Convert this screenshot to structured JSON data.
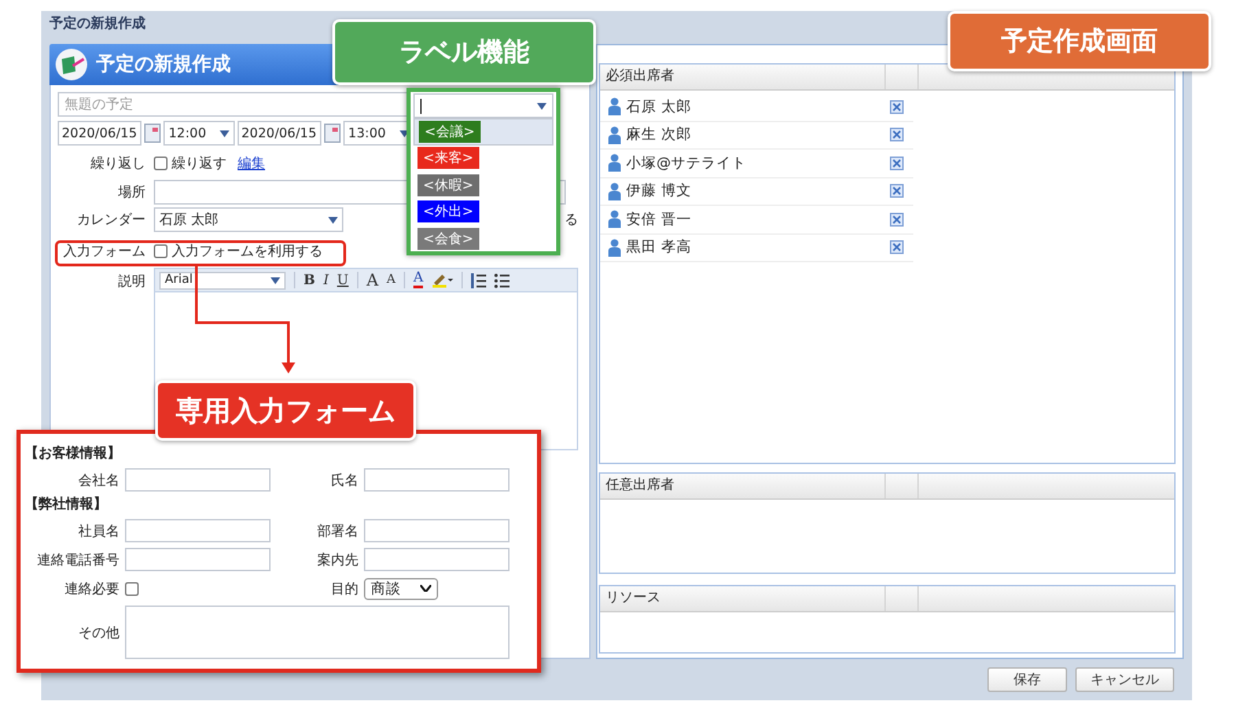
{
  "window": {
    "title": "予定の新規作成"
  },
  "header": {
    "title": "予定の新規作成"
  },
  "form": {
    "title_placeholder": "無題の予定",
    "start_date": "2020/06/15",
    "start_time": "12:00",
    "end_date": "2020/06/15",
    "end_time": "13:00",
    "repeat": {
      "label": "繰り返し",
      "checked": false,
      "option": "繰り返す",
      "link": "編集"
    },
    "location": {
      "label": "場所"
    },
    "calendar": {
      "label": "カレンダー",
      "value": "石原 太郎",
      "trailing": "る"
    },
    "input_form": {
      "label": "入力フォーム",
      "checked": false,
      "option": "入力フォームを利用する"
    },
    "description": {
      "label": "説明",
      "font": "Arial",
      "toolbar": [
        {
          "kind": "bold",
          "text": "B"
        },
        {
          "kind": "italic",
          "text": "I"
        },
        {
          "kind": "underline",
          "text": "U"
        },
        {
          "kind": "grow",
          "text": "A"
        },
        {
          "kind": "shrink",
          "text": "A"
        },
        {
          "kind": "color",
          "text": "A"
        },
        {
          "kind": "highlight"
        },
        {
          "kind": "ordered"
        },
        {
          "kind": "bullets"
        }
      ]
    }
  },
  "label_menu": {
    "items": [
      {
        "text": "<会議>",
        "color": "#2e7d1e",
        "selected": true
      },
      {
        "text": "<来客>",
        "color": "#e8291c",
        "selected": false
      },
      {
        "text": "<休暇>",
        "color": "#6e6e6e",
        "selected": false
      },
      {
        "text": "<外出>",
        "color": "#0000ff",
        "selected": false
      },
      {
        "text": "<会食>",
        "color": "#7a7a7a",
        "selected": false
      }
    ]
  },
  "required_attendees": {
    "title": "必須出席者",
    "people": [
      "石原 太郎",
      "麻生 次郎",
      "小塚@サテライト",
      "伊藤 博文",
      "安倍 晋一",
      "黒田 孝高"
    ]
  },
  "optional_attendees": {
    "title": "任意出席者"
  },
  "resources": {
    "title": "リソース"
  },
  "buttons": [
    "保存",
    "キャンセル"
  ],
  "callouts": {
    "label_feature": "ラベル機能",
    "screen": "予定作成画面",
    "custom_form": "専用入力フォーム"
  },
  "custom_form": {
    "sections": [
      {
        "title": "【お客様情報】",
        "rows": [
          [
            {
              "kind": "text",
              "label": "会社名"
            },
            {
              "kind": "text",
              "label": "氏名"
            }
          ]
        ]
      },
      {
        "title": "【弊社情報】",
        "rows": [
          [
            {
              "kind": "text",
              "label": "社員名"
            },
            {
              "kind": "text",
              "label": "部署名"
            }
          ],
          [
            {
              "kind": "text",
              "label": "連絡電話番号"
            },
            {
              "kind": "text",
              "label": "案内先"
            }
          ],
          [
            {
              "kind": "checkbox",
              "label": "連絡必要",
              "checked": false
            },
            {
              "kind": "select",
              "label": "目的",
              "value": "商談"
            }
          ]
        ]
      }
    ],
    "other": {
      "label": "その他"
    }
  }
}
